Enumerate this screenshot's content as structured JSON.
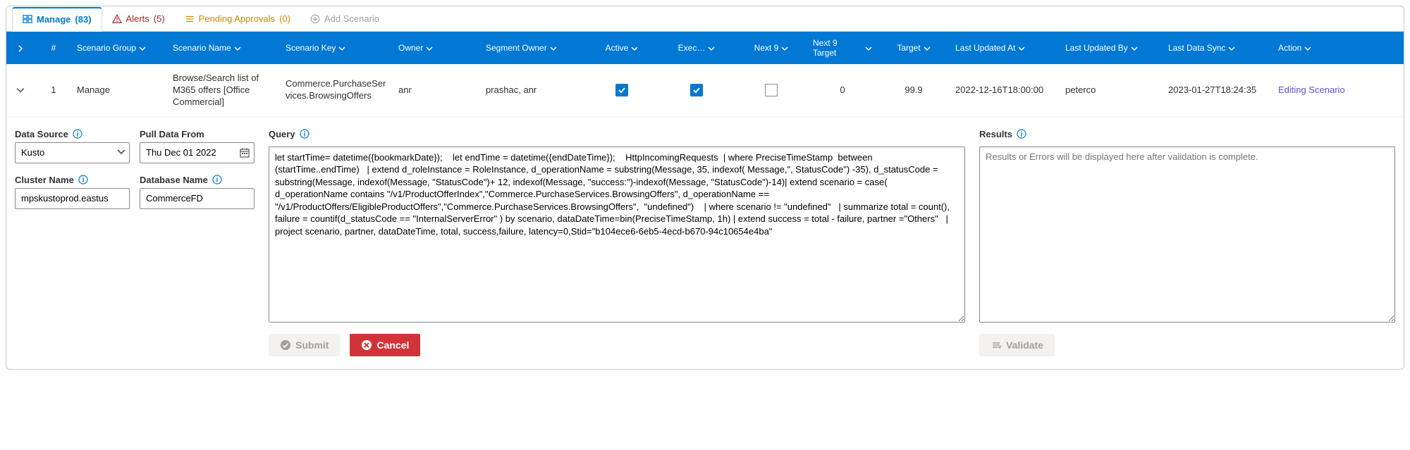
{
  "tabs": {
    "manage": {
      "label": "Manage",
      "count": "(83)"
    },
    "alerts": {
      "label": "Alerts",
      "count": "(5)"
    },
    "pending": {
      "label": "Pending Approvals",
      "count": "(0)"
    },
    "add": {
      "label": "Add Scenario"
    }
  },
  "headers": {
    "num": "#",
    "scenario_group": "Scenario Group",
    "scenario_name": "Scenario Name",
    "scenario_key": "Scenario Key",
    "owner": "Owner",
    "segment_owner": "Segment Owner",
    "active": "Active",
    "exec": "Exec…",
    "next9": "Next 9",
    "next9_target": "Next 9 Target",
    "target": "Target",
    "last_updated_at": "Last Updated At",
    "last_updated_by": "Last Updated By",
    "last_data_sync": "Last Data Sync",
    "action": "Action"
  },
  "row": {
    "num": "1",
    "scenario_group": "Manage",
    "scenario_name": "Browse/Search list of M365 offers [Office Commercial]",
    "scenario_key": "Commerce.PurchaseServices.BrowsingOffers",
    "owner": "anr",
    "segment_owner": "prashac, anr",
    "active": true,
    "exec": true,
    "next9": false,
    "next9_target": "0",
    "target": "99.9",
    "last_updated_at": "2022-12-16T18:00:00",
    "last_updated_by": "peterco",
    "last_data_sync": "2023-01-27T18:24:35",
    "action": "Editing Scenario"
  },
  "details": {
    "data_source_label": "Data Source",
    "data_source_value": "Kusto",
    "pull_data_from_label": "Pull Data From",
    "pull_data_from_value": "Thu Dec 01 2022",
    "cluster_name_label": "Cluster Name",
    "cluster_name_value": "mpskustoprod.eastus",
    "database_name_label": "Database Name",
    "database_name_value": "CommerceFD",
    "query_label": "Query",
    "query_value": "let startTime= datetime({bookmarkDate});    let endTime = datetime({endDateTime});    HttpIncomingRequests  | where PreciseTimeStamp  between (startTime..endTime)   | extend d_roleInstance = RoleInstance, d_operationName = substring(Message, 35, indexof( Message,\", StatusCode\") -35), d_statusCode = substring(Message, indexof(Message, \"StatusCode\")+ 12, indexof(Message, \"success:\")-indexof(Message, \"StatusCode\")-14)| extend scenario = case(  d_operationName contains \"/v1/ProductOfferIndex\",\"Commerce.PurchaseServices.BrowsingOffers\", d_operationName == \"/v1/ProductOffers/EligibleProductOffers\",\"Commerce.PurchaseServices.BrowsingOffers\",  \"undefined\")    | where scenario != \"undefined\"   | summarize total = count(), failure = countif(d_statusCode == \"InternalServerError\" ) by scenario, dataDateTime=bin(PreciseTimeStamp, 1h) | extend success = total - failure, partner =\"Others\"   | project scenario, partner, dataDateTime, total, success,failure, latency=0,Stid=\"b104ece6-6eb5-4ecd-b670-94c10654e4ba\"",
    "results_label": "Results",
    "results_placeholder": "Results or Errors will be displayed here after validation is complete.",
    "submit_label": "Submit",
    "cancel_label": "Cancel",
    "validate_label": "Validate"
  }
}
